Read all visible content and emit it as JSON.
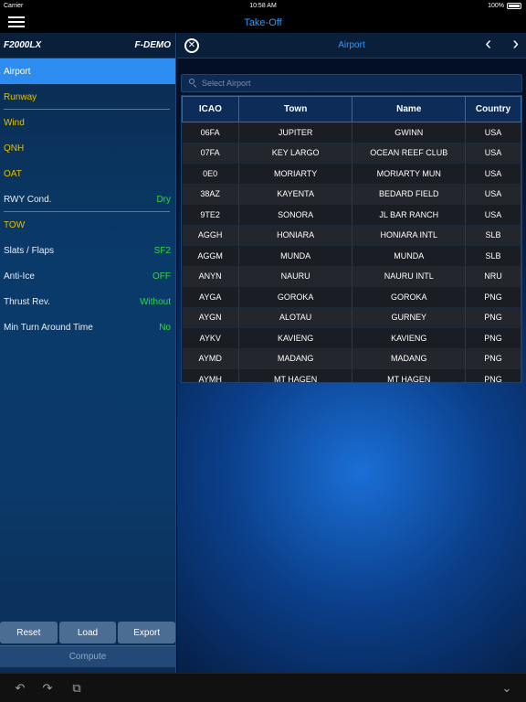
{
  "status_bar": {
    "carrier": "Carrier",
    "time": "10:58 AM",
    "battery": "100%"
  },
  "nav": {
    "title": "Take-Off"
  },
  "left": {
    "aircraft": "F2000LX",
    "registration": "F-DEMO",
    "items": [
      {
        "label": "Airport",
        "value": ""
      },
      {
        "label": "Runway",
        "value": ""
      },
      {
        "label": "Wind",
        "value": ""
      },
      {
        "label": "QNH",
        "value": ""
      },
      {
        "label": "OAT",
        "value": ""
      },
      {
        "label": "RWY Cond.",
        "value": "Dry"
      },
      {
        "label": "TOW",
        "value": ""
      },
      {
        "label": "Slats / Flaps",
        "value": "SF2"
      },
      {
        "label": "Anti-Ice",
        "value": "OFF"
      },
      {
        "label": "Thrust Rev.",
        "value": "Without"
      },
      {
        "label": "Min Turn Around Time",
        "value": "No"
      }
    ],
    "buttons": {
      "reset": "Reset",
      "load": "Load",
      "export": "Export",
      "compute": "Compute"
    }
  },
  "right": {
    "title": "Airport",
    "close": "✕",
    "prev": "‹",
    "next": "›",
    "search_placeholder": "Select Airport",
    "columns": [
      "ICAO",
      "Town",
      "Name",
      "Country"
    ],
    "rows": [
      [
        "06FA",
        "JUPITER",
        "GWINN",
        "USA"
      ],
      [
        "07FA",
        "KEY LARGO",
        "OCEAN REEF CLUB",
        "USA"
      ],
      [
        "0E0",
        "MORIARTY",
        "MORIARTY MUN",
        "USA"
      ],
      [
        "38AZ",
        "KAYENTA",
        "BEDARD FIELD",
        "USA"
      ],
      [
        "9TE2",
        "SONORA",
        "JL BAR RANCH",
        "USA"
      ],
      [
        "AGGH",
        "HONIARA",
        "HONIARA INTL",
        "SLB"
      ],
      [
        "AGGM",
        "MUNDA",
        "MUNDA",
        "SLB"
      ],
      [
        "ANYN",
        "NAURU",
        "NAURU INTL",
        "NRU"
      ],
      [
        "AYGA",
        "GOROKA",
        "GOROKA",
        "PNG"
      ],
      [
        "AYGN",
        "ALOTAU",
        "GURNEY",
        "PNG"
      ],
      [
        "AYKV",
        "KAVIENG",
        "KAVIENG",
        "PNG"
      ],
      [
        "AYMD",
        "MADANG",
        "MADANG",
        "PNG"
      ],
      [
        "AYMH",
        "MT HAGEN",
        "MT HAGEN",
        "PNG"
      ]
    ]
  },
  "toolbar": {
    "undo": "↶",
    "redo": "↷",
    "copy": "⧉",
    "collapse": "⌄"
  }
}
